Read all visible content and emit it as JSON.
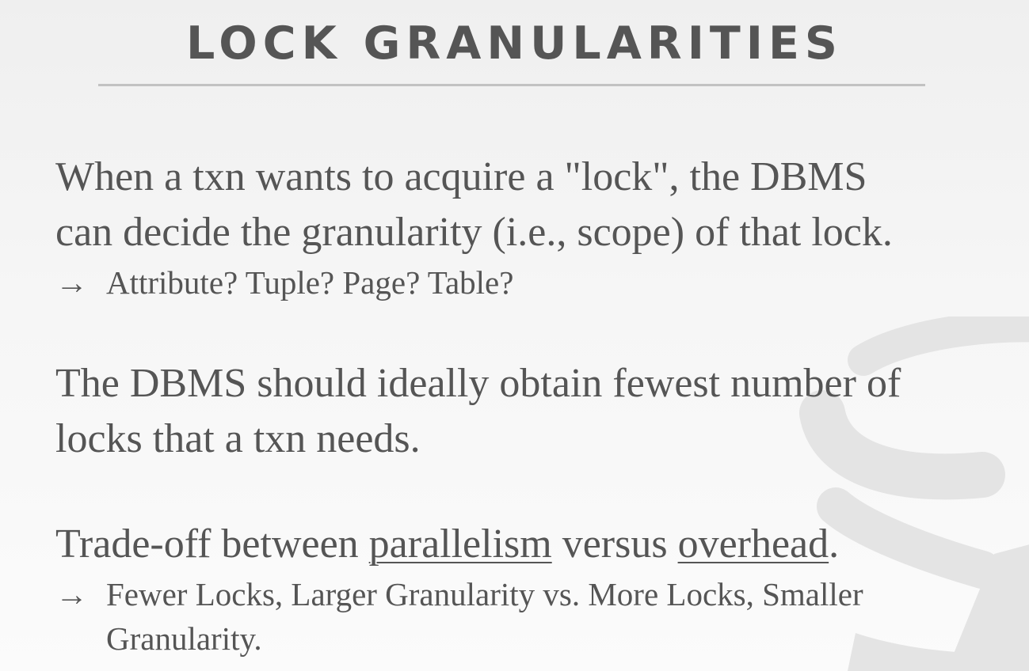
{
  "slide": {
    "title": "LOCK GRANULARITIES",
    "paragraph1": {
      "line1": "When a txn wants to acquire a \"lock\", the DBMS",
      "line2": "can decide the granularity (i.e., scope) of that lock.",
      "bullet_arrow": "→",
      "bullet": "Attribute? Tuple? Page? Table?"
    },
    "paragraph2": {
      "line1": "The DBMS should ideally obtain fewest number of",
      "line2": "locks that a txn needs."
    },
    "paragraph3": {
      "prefix": "Trade-off between ",
      "term1": "parallelism",
      "middle": " versus ",
      "term2": "overhead",
      "suffix": ".",
      "bullet_arrow": "→",
      "bullet_line1": "Fewer Locks, Larger Granularity vs. More Locks, Smaller",
      "bullet_line2": "Granularity."
    },
    "watermark_icon": "database-cylinder-icon"
  },
  "colors": {
    "text": "#555555",
    "rule": "#c2c2c2",
    "watermark": "#e4e4e4"
  }
}
